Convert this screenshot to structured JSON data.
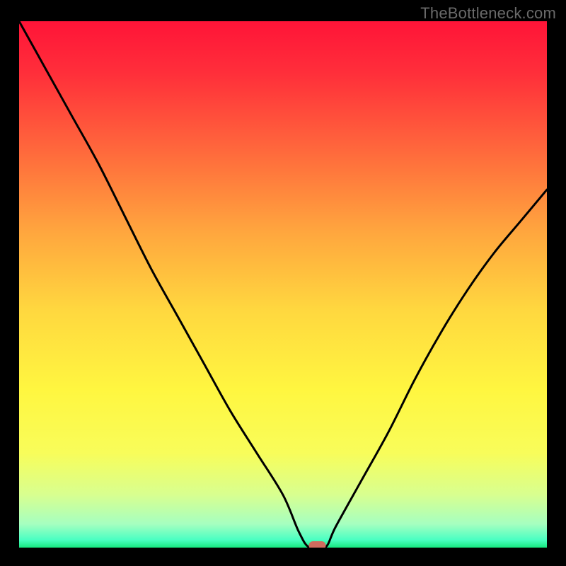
{
  "attribution": "TheBottleneck.com",
  "chart_data": {
    "type": "line",
    "title": "",
    "xlabel": "",
    "ylabel": "",
    "xlim": [
      0,
      100
    ],
    "ylim": [
      0,
      100
    ],
    "minimum_x": 55,
    "series": [
      {
        "name": "curve",
        "x": [
          0,
          5,
          10,
          15,
          20,
          25,
          30,
          35,
          40,
          45,
          50,
          53,
          55,
          58,
          60,
          65,
          70,
          75,
          80,
          85,
          90,
          95,
          100
        ],
        "y": [
          100,
          91,
          82,
          73,
          63,
          53,
          44,
          35,
          26,
          18,
          10,
          3,
          0,
          0,
          4,
          13,
          22,
          32,
          41,
          49,
          56,
          62,
          68
        ]
      }
    ],
    "marker": {
      "x": 56.5,
      "y": 0,
      "color": "#d06b5e"
    },
    "gradient_stops": [
      {
        "offset": 0.0,
        "color": "#ff1438"
      },
      {
        "offset": 0.1,
        "color": "#ff2f3a"
      },
      {
        "offset": 0.25,
        "color": "#ff6a3c"
      },
      {
        "offset": 0.4,
        "color": "#ffa63e"
      },
      {
        "offset": 0.55,
        "color": "#ffd83f"
      },
      {
        "offset": 0.7,
        "color": "#fff640"
      },
      {
        "offset": 0.82,
        "color": "#f8fd5a"
      },
      {
        "offset": 0.9,
        "color": "#d8ff90"
      },
      {
        "offset": 0.955,
        "color": "#a6ffc0"
      },
      {
        "offset": 0.985,
        "color": "#4bffc2"
      },
      {
        "offset": 1.0,
        "color": "#17e87f"
      }
    ]
  }
}
